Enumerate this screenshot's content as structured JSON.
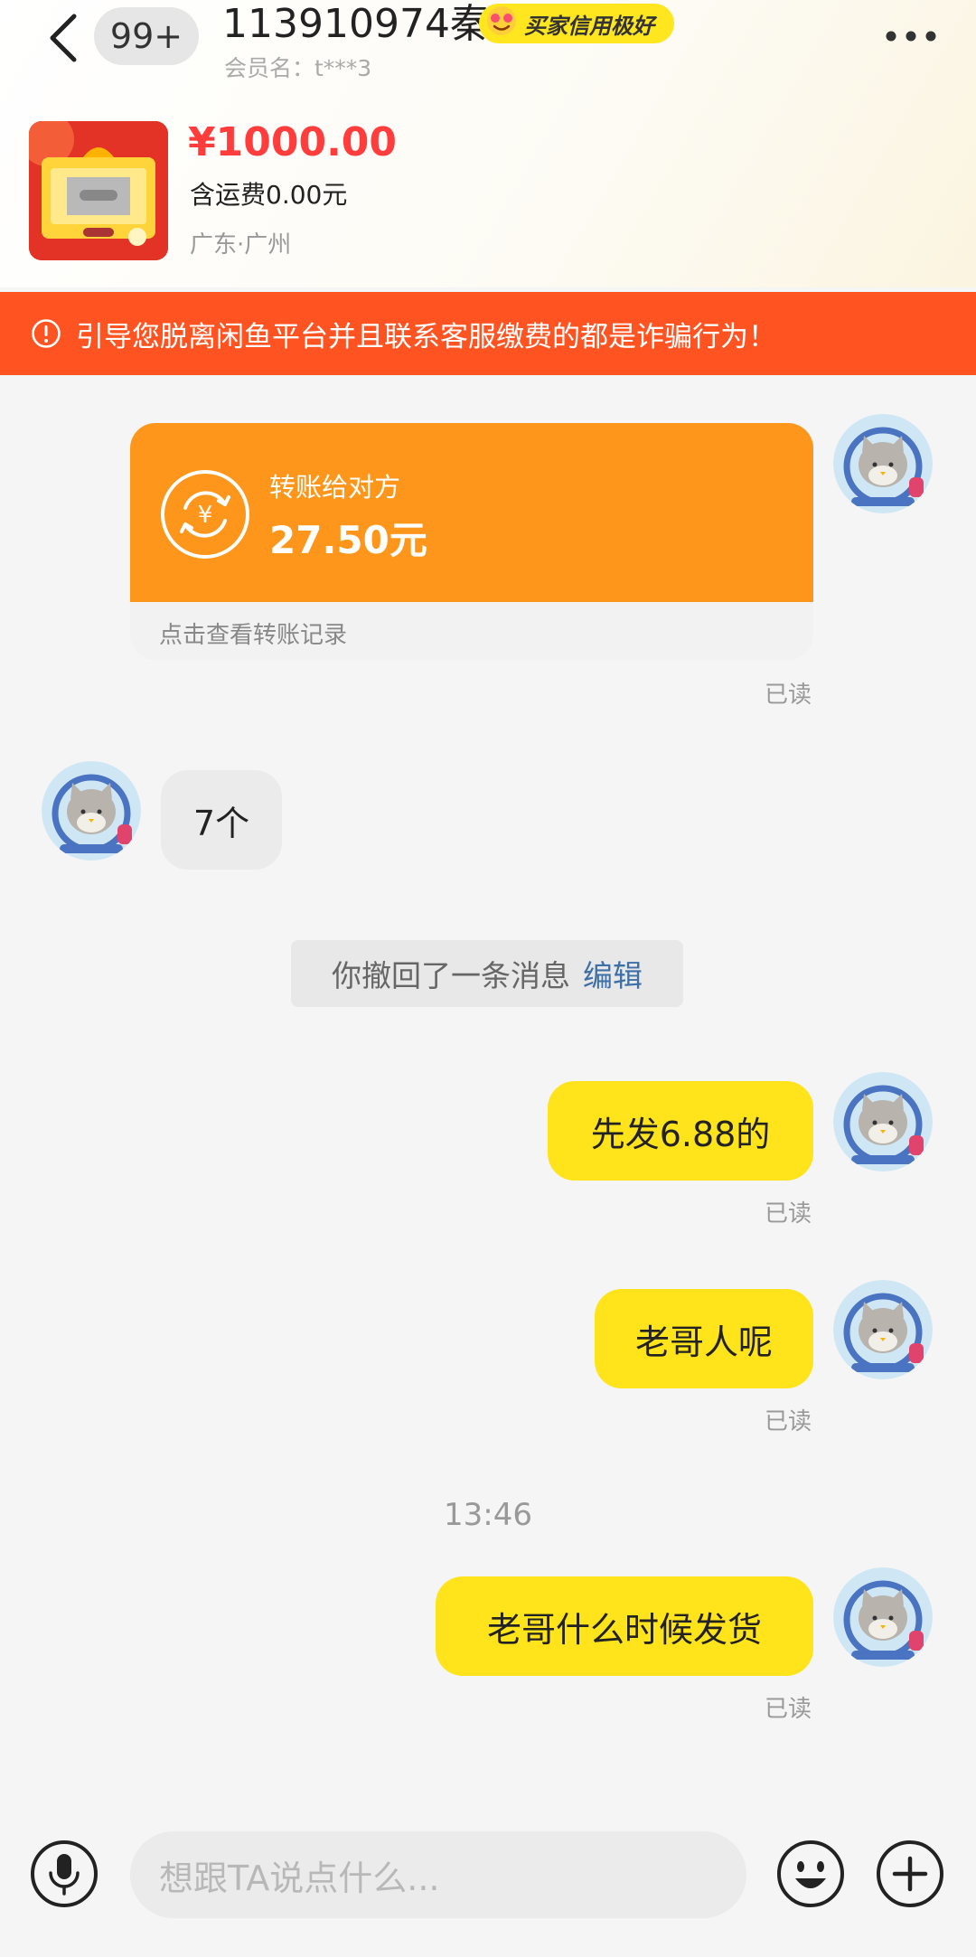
{
  "header": {
    "unread_badge": "99+",
    "title": "113910974秦",
    "credit_tag": "买家信用极好",
    "member_name": "会员名：t***3"
  },
  "item": {
    "price": "¥1000.00",
    "shipping": "含运费0.00元",
    "location": "广东·广州"
  },
  "warning": {
    "text": "引导您脱离闲鱼平台并且联系客服缴费的都是诈骗行为！"
  },
  "messages": {
    "transfer": {
      "label": "转账给对方",
      "amount": "27.50元",
      "link": "点击查看转账记录",
      "read": "已读"
    },
    "incoming_1": "7个",
    "system": {
      "text": "你撤回了一条消息",
      "action": "编辑"
    },
    "outgoing_1": {
      "text": "先发6.88的",
      "read": "已读"
    },
    "outgoing_2": {
      "text": "老哥人呢",
      "read": "已读"
    },
    "timestamp": "13:46",
    "outgoing_3": {
      "text": "老哥什么时候发货",
      "read": "已读"
    }
  },
  "input_bar": {
    "placeholder": "想跟TA说点什么..."
  },
  "colors": {
    "accent_yellow": "#ffe31b",
    "price_red": "#ff3d3d",
    "warning_orange": "#ff5421",
    "transfer_orange": "#fd961b",
    "link_blue": "#3e6fa7"
  },
  "icons": [
    "back-arrow-icon",
    "more-dots-icon",
    "warning-circle-icon",
    "yuan-transfer-icon",
    "microphone-icon",
    "emoji-icon",
    "plus-icon"
  ]
}
